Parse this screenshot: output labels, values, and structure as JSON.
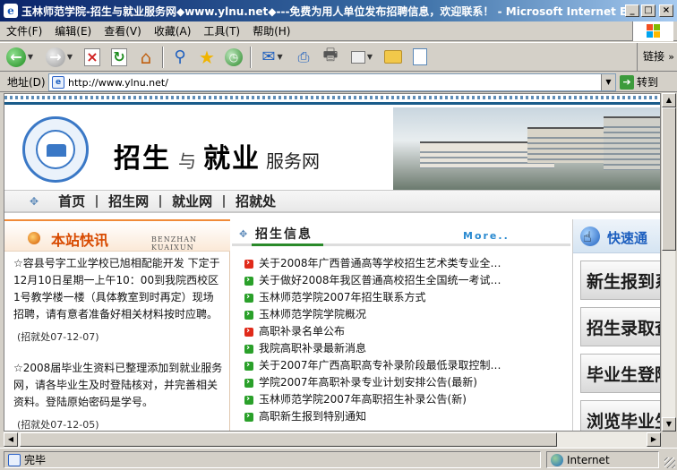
{
  "window": {
    "title": "玉林师范学院-招生与就业服务网◆www.ylnu.net◆---免费为用人单位发布招聘信息，欢迎联系！ - Microsoft Internet Explorer"
  },
  "menu": [
    "文件(F)",
    "编辑(E)",
    "查看(V)",
    "收藏(A)",
    "工具(T)",
    "帮助(H)"
  ],
  "toolbar": {
    "links_label": "链接",
    "icons": [
      "back-icon",
      "forward-icon",
      "stop-icon",
      "refresh-icon",
      "home-icon",
      "search-icon",
      "favorites-icon",
      "history-icon",
      "mail-icon",
      "print-preview-icon",
      "print-icon",
      "edit-icon",
      "folder-icon",
      "messenger-icon"
    ]
  },
  "address": {
    "label": "地址(D)",
    "url": "http://www.ylnu.net/",
    "go_label": "转到"
  },
  "site": {
    "title_zhao": "招生",
    "title_yu": "与",
    "title_jiu": "就业",
    "title_rest": "服务网",
    "nav": [
      "首页",
      "招生网",
      "就业网",
      "招就处"
    ]
  },
  "left": {
    "title": "本站快讯",
    "title_en": "BENZHAN KUAIXUN",
    "paragraphs": [
      "☆容县号字工业学校已旭相配能开发 下定于12月10日星期一上午10：00到我院西校区1号教学楼一楼（具体教室到时再定）现场招聘，请有意者准备好相关材料按时应聘。",
      "(招就处07-12-07)",
      "☆2008届毕业生资料已整理添加到就业服务网，请各毕业生及时登陆核对，并完善相关资料。登陆原始密码是学号。",
      "(招就处07-12-05)"
    ]
  },
  "center": {
    "title": "招生信息",
    "more_label": "More..",
    "items": [
      {
        "text": "关于2008年广西普通高等学校招生艺术类专业全…",
        "marker": "red"
      },
      {
        "text": "关于做好2008年我区普通高校招生全国统一考试…",
        "marker": "green"
      },
      {
        "text": "玉林师范学院2007年招生联系方式",
        "marker": "green"
      },
      {
        "text": "玉林师范学院学院概况",
        "marker": "green"
      },
      {
        "text": "高职补录名单公布",
        "marker": "red"
      },
      {
        "text": "我院高职补录最新消息",
        "marker": "green"
      },
      {
        "text": "关于2007年广西高职高专补录阶段最低录取控制…",
        "marker": "green"
      },
      {
        "text": "学院2007年高职补录专业计划安排公告(最新)",
        "marker": "green"
      },
      {
        "text": "玉林师范学院2007年高职招生补录公告(新)",
        "marker": "green"
      },
      {
        "text": "高职新生报到特别通知",
        "marker": "green"
      }
    ]
  },
  "right": {
    "title": "快速通",
    "buttons": [
      "新生报到系",
      "招生录取查",
      "毕业生登陆",
      "浏览毕业生"
    ]
  },
  "status": {
    "text": "完毕",
    "zone": "Internet"
  }
}
